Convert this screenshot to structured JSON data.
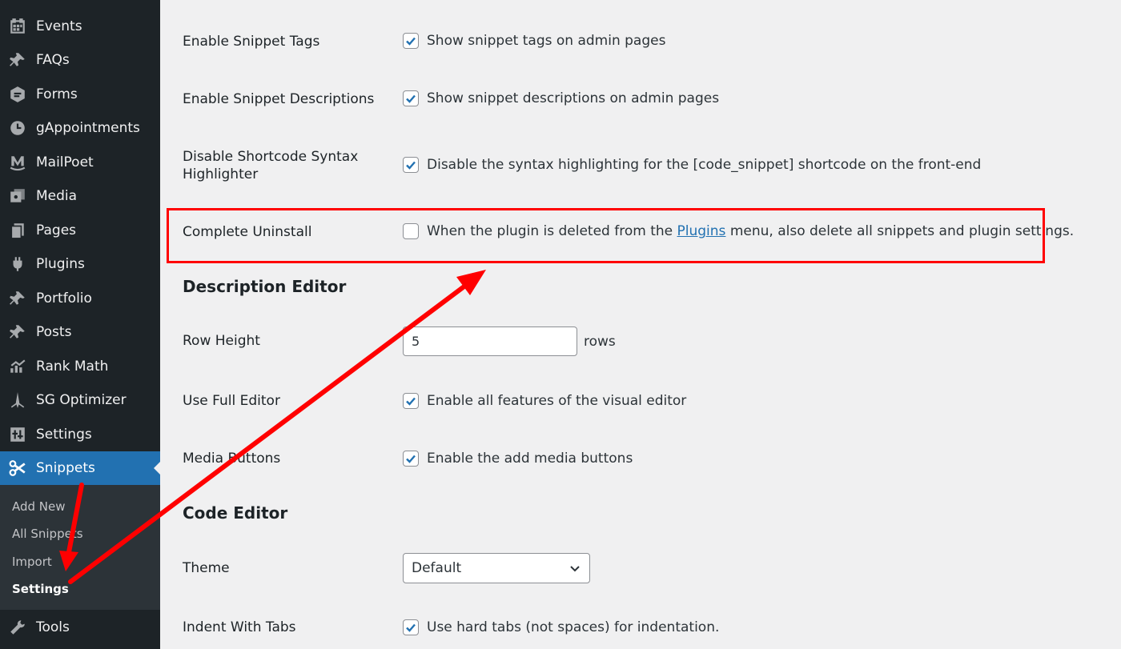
{
  "sidebar": {
    "items": [
      {
        "label": "Events",
        "icon": "calendar-icon"
      },
      {
        "label": "FAQs",
        "icon": "pin-icon"
      },
      {
        "label": "Forms",
        "icon": "forms-icon"
      },
      {
        "label": "gAppointments",
        "icon": "clock-icon"
      },
      {
        "label": "MailPoet",
        "icon": "mailpoet-icon"
      },
      {
        "label": "Media",
        "icon": "media-icon"
      },
      {
        "label": "Pages",
        "icon": "pages-icon"
      },
      {
        "label": "Plugins",
        "icon": "plugins-icon"
      },
      {
        "label": "Portfolio",
        "icon": "pin-icon"
      },
      {
        "label": "Posts",
        "icon": "pin-icon"
      },
      {
        "label": "Rank Math",
        "icon": "rankmath-icon"
      },
      {
        "label": "SG Optimizer",
        "icon": "sg-optimizer-icon"
      },
      {
        "label": "Settings",
        "icon": "settings-icon"
      },
      {
        "label": "Snippets",
        "icon": "scissors-icon"
      },
      {
        "label": "Tools",
        "icon": "wrench-icon"
      }
    ],
    "submenu": [
      "Add New",
      "All Snippets",
      "Import",
      "Settings"
    ]
  },
  "settings": {
    "tags_label": "Enable Snippet Tags",
    "tags_desc": "Show snippet tags on admin pages",
    "descs_label": "Enable Snippet Descriptions",
    "descs_desc": "Show snippet descriptions on admin pages",
    "shortcode_label_1": "Disable Shortcode Syntax",
    "shortcode_label_2": "Highlighter",
    "shortcode_desc": "Disable the syntax highlighting for the [code_snippet] shortcode on the front-end",
    "uninstall_label": "Complete Uninstall",
    "uninstall_desc_pre": "When the plugin is deleted from the ",
    "uninstall_link": "Plugins",
    "uninstall_desc_post": " menu, also delete all snippets and plugin settings.",
    "desc_editor_title": "Description Editor",
    "row_height_label": "Row Height",
    "row_height_value": "5",
    "row_height_unit": "rows",
    "full_editor_label": "Use Full Editor",
    "full_editor_desc": "Enable all features of the visual editor",
    "media_buttons_label": "Media Buttons",
    "media_buttons_desc": "Enable the add media buttons",
    "code_editor_title": "Code Editor",
    "theme_label": "Theme",
    "theme_value": "Default",
    "indent_label": "Indent With Tabs",
    "indent_desc": "Use hard tabs (not spaces) for indentation."
  },
  "checkbox_state": {
    "tags": true,
    "descs": true,
    "shortcode": true,
    "uninstall": false,
    "full_editor": true,
    "media_buttons": true,
    "indent": true
  },
  "colors": {
    "sidebar_bg": "#1d2327",
    "active_item": "#2271b1",
    "annotation": "#ff0000",
    "checkbox_tick": "#2271b1"
  }
}
